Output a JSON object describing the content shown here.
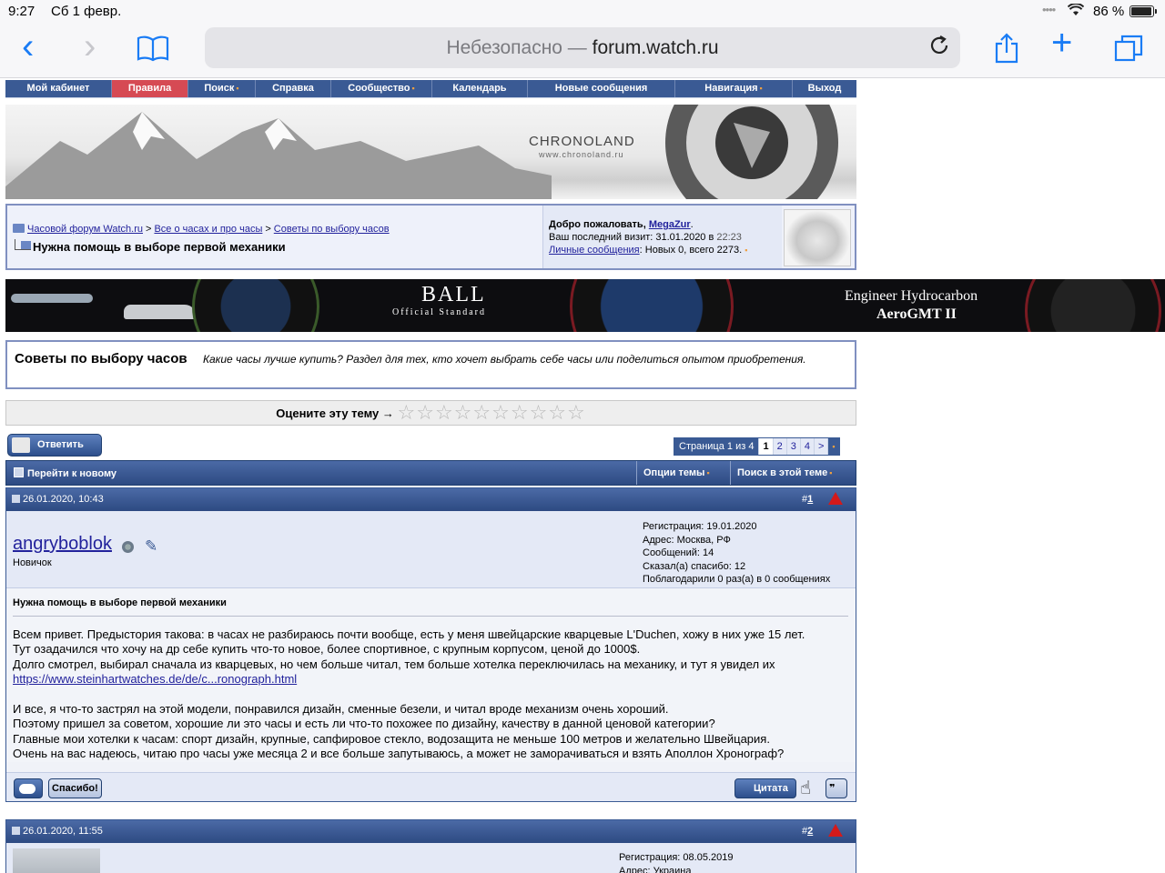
{
  "status": {
    "time": "9:27",
    "date": "Сб 1 февр.",
    "battery_pct": "86 %",
    "battery_level": 0.86
  },
  "browser": {
    "insecure_label": "Небезопасно —",
    "domain": "forum.watch.ru"
  },
  "nav": {
    "items": [
      {
        "label": "Мой кабинет"
      },
      {
        "label": "Правила",
        "active": true
      },
      {
        "label": "Поиск",
        "dropdown": true
      },
      {
        "label": "Справка"
      },
      {
        "label": "Сообщество",
        "dropdown": true
      },
      {
        "label": "Календарь"
      },
      {
        "label": "Новые сообщения"
      },
      {
        "label": "Навигация",
        "dropdown": true
      },
      {
        "label": "Выход"
      }
    ]
  },
  "banner_top": {
    "logo": "CHRONOLAND",
    "url": "www.chronoland.ru"
  },
  "breadcrumb": {
    "items": [
      "Часовой форум Watch.ru",
      "Все о часах и про часы",
      "Советы по выбору часов"
    ],
    "separator": ">",
    "current": "Нужна помощь в выборе первой механики"
  },
  "welcome": {
    "greeting": "Добро пожаловать,",
    "username": "MegaZur",
    "last_visit_label": "Ваш последний визит: 31.01.2020 в",
    "last_visit_time": "22:23",
    "pm_link": "Личные сообщения",
    "pm_text": ": Новых 0, всего 2273."
  },
  "banner_ball": {
    "brand": "BALL",
    "tagline": "Official  Standard",
    "model_line1": "Engineer Hydrocarbon",
    "model_line2": "AeroGMT II"
  },
  "forum": {
    "name": "Советы по выбору часов",
    "description": "Какие часы лучше купить? Раздел для тех, кто хочет выбрать себе часы или поделиться опытом приобретения."
  },
  "rating": {
    "label": "Оцените эту тему →",
    "stars": "☆☆☆☆☆☆☆☆☆☆"
  },
  "actions": {
    "reply": "Ответить"
  },
  "pager": {
    "label": "Страница 1 из 4",
    "current": "1",
    "pages": [
      "2",
      "3",
      "4"
    ],
    "next": ">"
  },
  "threadbar": {
    "goto_new": "Перейти к новому",
    "options": "Опции темы",
    "search": "Поиск в этой теме"
  },
  "posts": [
    {
      "date": "26.01.2020, 10:43",
      "num_prefix": "#",
      "num": "1",
      "username": "angryboblok",
      "rank": "Новичок",
      "info": [
        "Регистрация: 19.01.2020",
        "Адрес: Москва, РФ",
        "Сообщений: 14",
        "Сказал(а) спасибо: 12",
        "Поблагодарили 0 раз(а) в 0 сообщениях"
      ],
      "title": "Нужна помощь в выборе первой механики",
      "text_1": "Всем привет. Предыстория такова: в часах не разбираюсь почти вообще, есть у меня швейцарские кварцевые L'Duchen, хожу в них уже 15 лет.\nТут озадачился что хочу на др себе купить что-то новое, более спортивное, с крупным корпусом, ценой до 1000$.\nДолго смотрел, выбирал сначала из кварцевых, но чем больше читал, тем больше хотелка переключилась на механику, и тут я увидел их",
      "link": "https://www.steinhartwatches.de/de/c...ronograph.html",
      "text_2": "И все, я что-то застрял на этой модели, понравился дизайн, сменные безели, и читал вроде механизм очень хороший.\nПоэтому пришел за советом, хорошие ли это часы и есть ли что-то похожее по дизайну, качеству в данной ценовой категории?\nГлавные мои хотелки к часам: спорт дизайн, крупные, сапфировое стекло, водозащита не меньше 100 метров и желательно Швейцария.\nОчень на вас надеюсь, читаю про часы уже месяца 2 и все больше запутываюсь, а может не заморачиваться и взять Аполлон Хронограф?",
      "thanks_button": "Спасибо!",
      "quote_button": "Цитата"
    },
    {
      "date": "26.01.2020, 11:55",
      "num_prefix": "#",
      "num": "2",
      "info": [
        "Регистрация: 08.05.2019",
        "Адрес: Украина"
      ]
    }
  ],
  "colors": {
    "nav_bg": "#3a5a94",
    "nav_active": "#d64a54",
    "link": "#22229c",
    "safari_blue": "#1a7cf5"
  }
}
